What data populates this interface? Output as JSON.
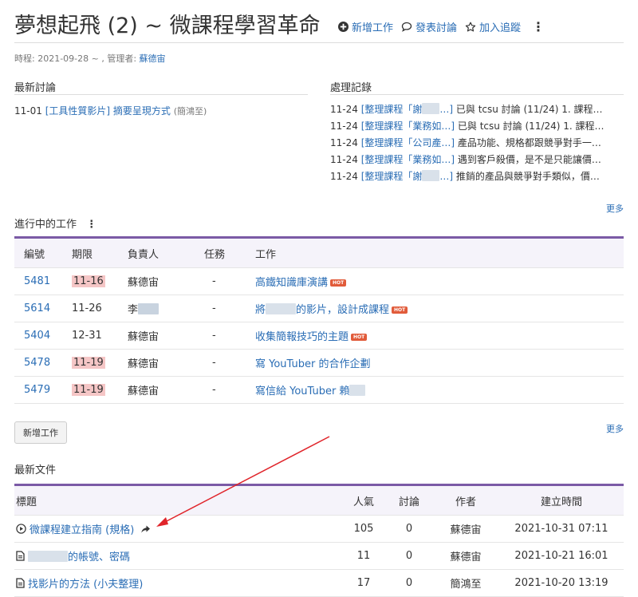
{
  "header": {
    "title": "夢想起飛 (2) ~ 微課程學習革命",
    "actions": {
      "new_task": "新增工作",
      "post_discussion": "發表討論",
      "follow": "加入追蹤"
    }
  },
  "meta": {
    "period_label": "時程: 2021-09-28 ~ , 管理者:",
    "manager": "蘇德宙"
  },
  "discussions": {
    "title": "最新討論",
    "items": [
      {
        "date": "11-01",
        "link": "[工具性質影片] 摘要呈現方式",
        "author": "(簡鴻至)"
      }
    ]
  },
  "records": {
    "title": "處理記錄",
    "items": [
      {
        "date": "11-24",
        "link_start": "[整理課程「謝",
        "link_end": "]",
        "text": " 已與 tcsu 討論 (11/24) 1. 課程…"
      },
      {
        "date": "11-24",
        "link_start": "[整理課程「業務如…",
        "link_end": "]",
        "text": " 已與 tcsu 討論 (11/24) 1. 課程…"
      },
      {
        "date": "11-24",
        "link_start": "[整理課程「公司產…",
        "link_end": "]",
        "text": " 產品功能、規格都跟競爭對手一…"
      },
      {
        "date": "11-24",
        "link_start": "[整理課程「業務如…",
        "link_end": "]",
        "text": " 遇到客戶殺價，是不是只能讓價…"
      },
      {
        "date": "11-24",
        "link_start": "[整理課程「謝",
        "link_end": "]",
        "text": " 推銷的產品與競爭對手類似，價…"
      }
    ],
    "more": "更多"
  },
  "tasks": {
    "title": "進行中的工作",
    "columns": [
      "編號",
      "期限",
      "負責人",
      "任務",
      "工作"
    ],
    "rows": [
      {
        "id": "5481",
        "due": "11-16",
        "due_highlight": true,
        "owner": "蘇德宙",
        "mission": "-",
        "work": "高鐵知識庫演講",
        "hot": true
      },
      {
        "id": "5614",
        "due": "11-26",
        "due_highlight": false,
        "owner": "李",
        "mission": "-",
        "work_prefix": "將",
        "work": "的影片，設計成課程",
        "hot": true
      },
      {
        "id": "5404",
        "due": "12-31",
        "due_highlight": false,
        "owner": "蘇德宙",
        "mission": "-",
        "work": "收集簡報技巧的主題",
        "hot": true
      },
      {
        "id": "5478",
        "due": "11-19",
        "due_highlight": true,
        "owner": "蘇德宙",
        "mission": "-",
        "work": "寫 YouTuber 的合作企劃",
        "hot": false
      },
      {
        "id": "5479",
        "due": "11-19",
        "due_highlight": true,
        "owner": "蘇德宙",
        "mission": "-",
        "work": "寫信給 YouTuber 賴",
        "hot": false
      }
    ],
    "hot_label": "HOT",
    "new_button": "新增工作",
    "more": "更多"
  },
  "documents": {
    "title": "最新文件",
    "columns": [
      "標題",
      "人氣",
      "討論",
      "作者",
      "建立時間"
    ],
    "rows": [
      {
        "icon": "play-circle-icon",
        "title": "微課程建立指南 (規格)",
        "views": "105",
        "comments": "0",
        "author": "蘇德宙",
        "created": "2021-10-31 07:11"
      },
      {
        "icon": "document-icon",
        "title": "的帳號、密碼",
        "views": "11",
        "comments": "0",
        "author": "蘇德宙",
        "created": "2021-10-21 16:01"
      },
      {
        "icon": "document-icon",
        "title": "找影片的方法 (小夫整理)",
        "views": "17",
        "comments": "0",
        "author": "簡鴻至",
        "created": "2021-10-20 13:19"
      }
    ]
  },
  "colors": {
    "accent": "#7b5aa6",
    "link": "#2a6db5",
    "overdue": "#f5c6c6",
    "hot_badge": "#e15b3a",
    "annotation_arrow": "#e0242a"
  }
}
